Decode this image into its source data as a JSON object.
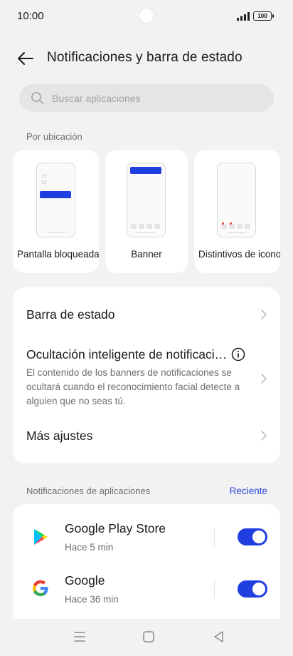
{
  "status_bar": {
    "time": "10:00",
    "battery": "100",
    "icons": [
      "signal-icon",
      "battery-icon"
    ]
  },
  "header": {
    "title": "Notificaciones y barra de estado",
    "back_icon": "arrow-left-icon"
  },
  "search": {
    "placeholder": "Buscar aplicaciones",
    "value": "",
    "icon": "search-icon"
  },
  "location_section": {
    "label": "Por ubicación",
    "cards": [
      {
        "label": "Pantalla bloqueada",
        "preview_clock": [
          "19",
          "50"
        ]
      },
      {
        "label": "Banner"
      },
      {
        "label": "Distintivos de iconos"
      }
    ]
  },
  "settings": [
    {
      "title": "Barra de estado"
    },
    {
      "title": "Ocultación inteligente de notificaciones",
      "description": "El contenido de los banners de notificaciones se ocultará cuando el reconocimiento facial detecte a alguien que no seas tú."
    },
    {
      "title": "Más ajustes"
    }
  ],
  "apps_section": {
    "label": "Notificaciones de aplicaciones",
    "sort_link": "Reciente",
    "apps": [
      {
        "name": "Google Play Store",
        "time": "Hace 5 min",
        "enabled": true,
        "icon": "google-play-icon"
      },
      {
        "name": "Google",
        "time": "Hace 36 min",
        "enabled": true,
        "icon": "google-icon"
      }
    ]
  },
  "nav_bar": {
    "icons": [
      "menu-icon",
      "home-icon",
      "back-triangle-icon"
    ]
  },
  "colors": {
    "accent": "#1f3fe0",
    "link": "#2a47d9",
    "background": "#f2f2f2",
    "card": "#ffffff",
    "secondary_text": "#6e6e6e"
  }
}
